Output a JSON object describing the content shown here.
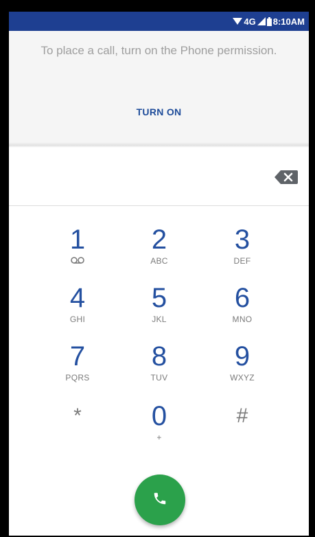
{
  "status_bar": {
    "network": "4G",
    "time": "8:10AM"
  },
  "permission": {
    "message": "To place a call, turn on the Phone permission.",
    "button_label": "TURN ON"
  },
  "dialer": {
    "digits_value": "",
    "keys": [
      {
        "num": "1",
        "sub": ""
      },
      {
        "num": "2",
        "sub": "ABC"
      },
      {
        "num": "3",
        "sub": "DEF"
      },
      {
        "num": "4",
        "sub": "GHI"
      },
      {
        "num": "5",
        "sub": "JKL"
      },
      {
        "num": "6",
        "sub": "MNO"
      },
      {
        "num": "7",
        "sub": "PQRS"
      },
      {
        "num": "8",
        "sub": "TUV"
      },
      {
        "num": "9",
        "sub": "WXYZ"
      },
      {
        "num": "*",
        "sub": ""
      },
      {
        "num": "0",
        "sub": "+"
      },
      {
        "num": "#",
        "sub": ""
      }
    ]
  },
  "icons": {
    "wifi": "wifi-icon",
    "signal": "signal-icon",
    "battery": "battery-icon",
    "voicemail": "voicemail-icon",
    "backspace": "backspace-icon",
    "call": "phone-icon"
  },
  "colors": {
    "status_bar": "#1e3f91",
    "accent": "#1e4c9a",
    "call_button": "#2ba14b"
  }
}
